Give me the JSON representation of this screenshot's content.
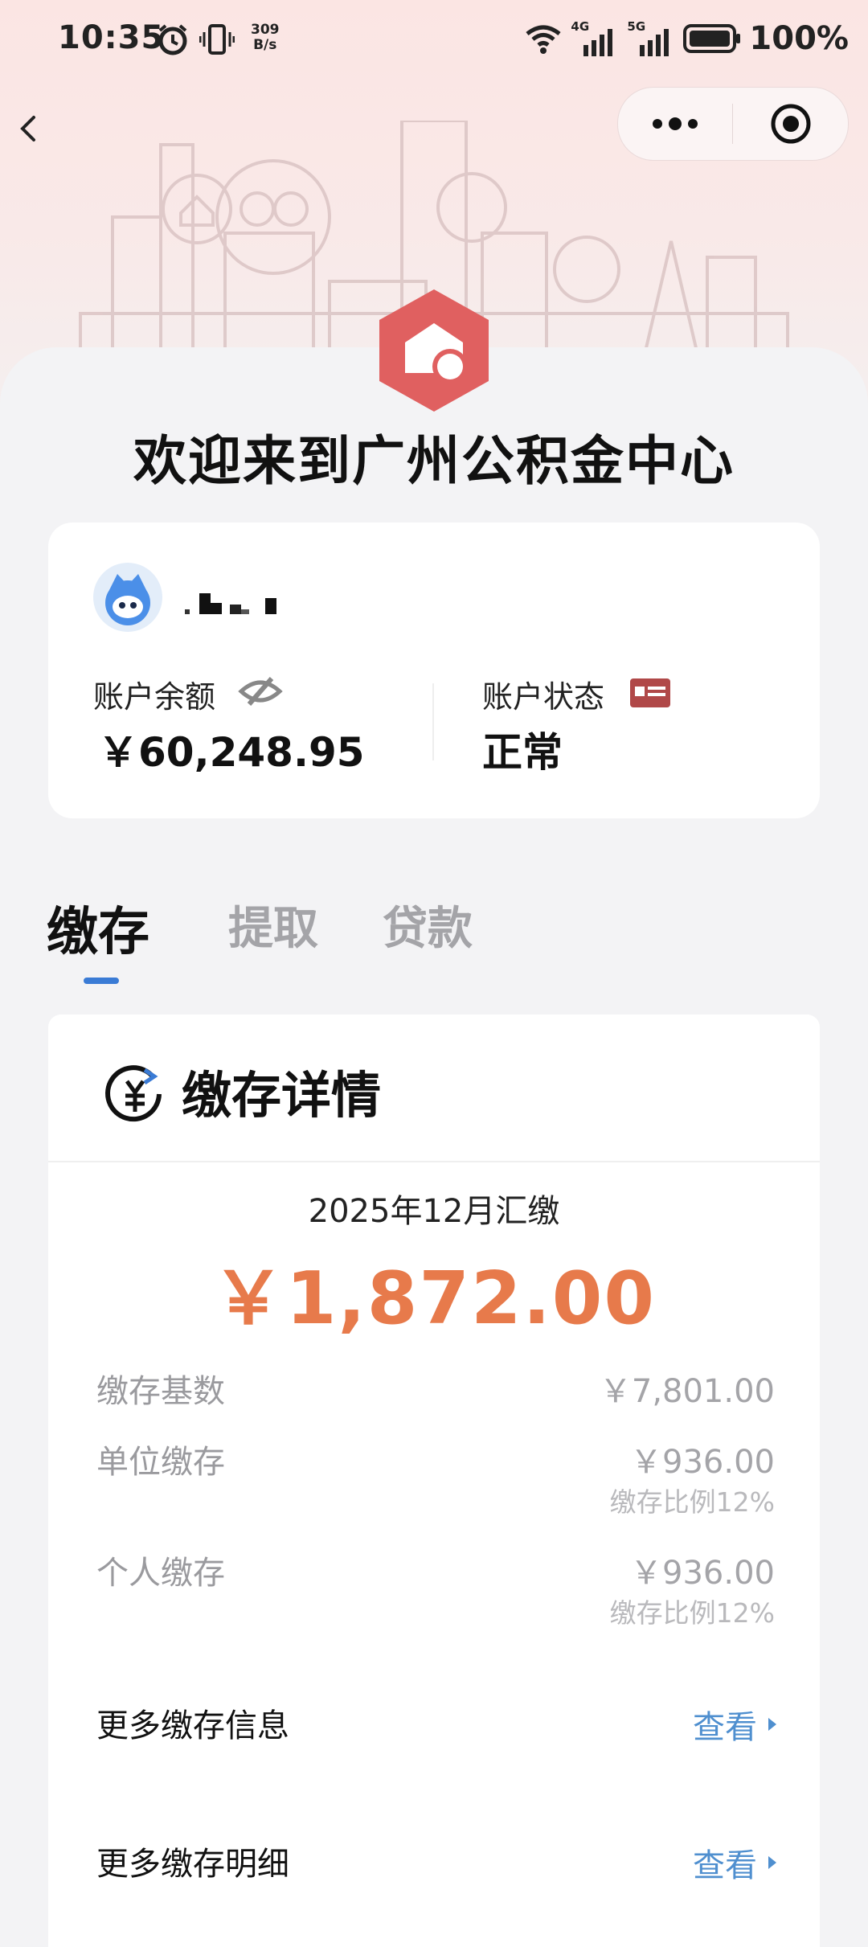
{
  "status_bar": {
    "time": "10:35",
    "net_speed_value": "309",
    "net_speed_unit": "B/s",
    "signal1": "4G",
    "signal2": "5G",
    "battery": "100%"
  },
  "welcome_title": "欢迎来到广州公积金中心",
  "account": {
    "balance_label": "账户余额",
    "balance_value": "￥60,248.95",
    "status_label": "账户状态",
    "status_value": "正常"
  },
  "tabs": [
    {
      "label": "缴存",
      "active": true
    },
    {
      "label": "提取",
      "active": false
    },
    {
      "label": "贷款",
      "active": false
    }
  ],
  "detail": {
    "title": "缴存详情",
    "month": "2025年12月汇缴",
    "amount": "￥1,872.00",
    "rows": [
      {
        "label": "缴存基数",
        "value": "￥7,801.00"
      },
      {
        "label": "单位缴存",
        "value": "￥936.00",
        "note": "缴存比例12%"
      },
      {
        "label": "个人缴存",
        "value": "￥936.00",
        "note": "缴存比例12%"
      }
    ],
    "links": [
      {
        "label": "更多缴存信息",
        "action": "查看"
      },
      {
        "label": "更多缴存明细",
        "action": "查看"
      }
    ]
  },
  "colors": {
    "accent_blue": "#3a7bd5",
    "amount_orange": "#e77a4b",
    "logo_red": "#e06060",
    "link_blue": "#4f8fcf"
  }
}
